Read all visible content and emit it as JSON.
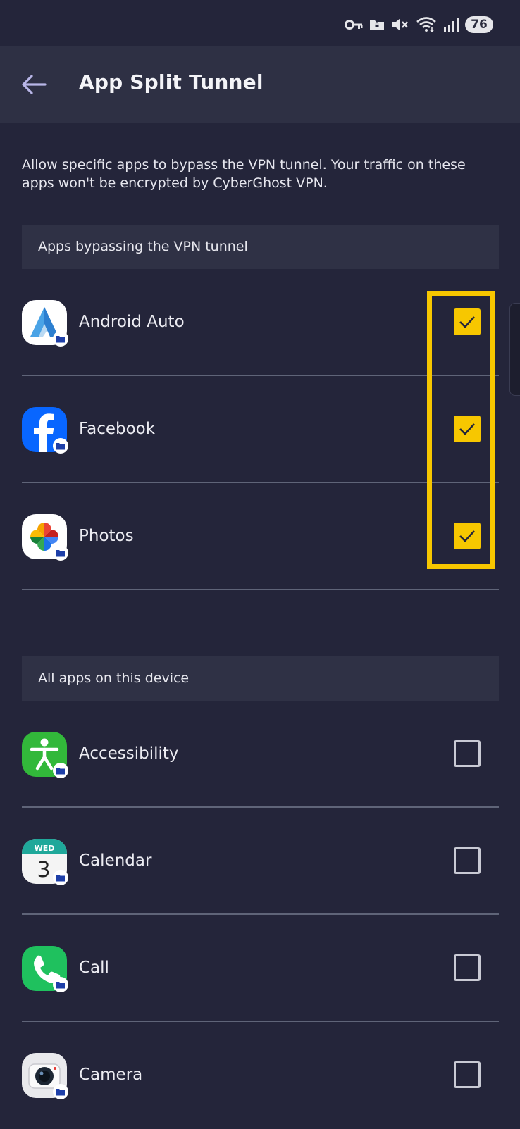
{
  "status_bar": {
    "battery": "76"
  },
  "app_bar": {
    "title": "App Split Tunnel"
  },
  "description": "Allow specific apps to bypass the VPN tunnel. Your traffic on these apps won't be encrypted by CyberGhost VPN.",
  "bypassing_section": {
    "header": "Apps bypassing the VPN tunnel",
    "apps": [
      {
        "name": "Android Auto",
        "checked": true,
        "icon": "android-auto-icon"
      },
      {
        "name": "Facebook",
        "checked": true,
        "icon": "facebook-icon"
      },
      {
        "name": "Photos",
        "checked": true,
        "icon": "photos-icon"
      }
    ]
  },
  "all_apps_section": {
    "header": "All apps on this device",
    "apps": [
      {
        "name": "Accessibility",
        "checked": false,
        "icon": "accessibility-icon"
      },
      {
        "name": "Calendar",
        "checked": false,
        "icon": "calendar-icon",
        "icon_text": {
          "day": "WED",
          "date": "3"
        }
      },
      {
        "name": "Call",
        "checked": false,
        "icon": "call-icon"
      },
      {
        "name": "Camera",
        "checked": false,
        "icon": "camera-icon"
      }
    ]
  },
  "colors": {
    "background": "#24253a",
    "app_bar": "#2e3044",
    "accent_yellow": "#f7c700",
    "section_header": "#2f3145"
  }
}
